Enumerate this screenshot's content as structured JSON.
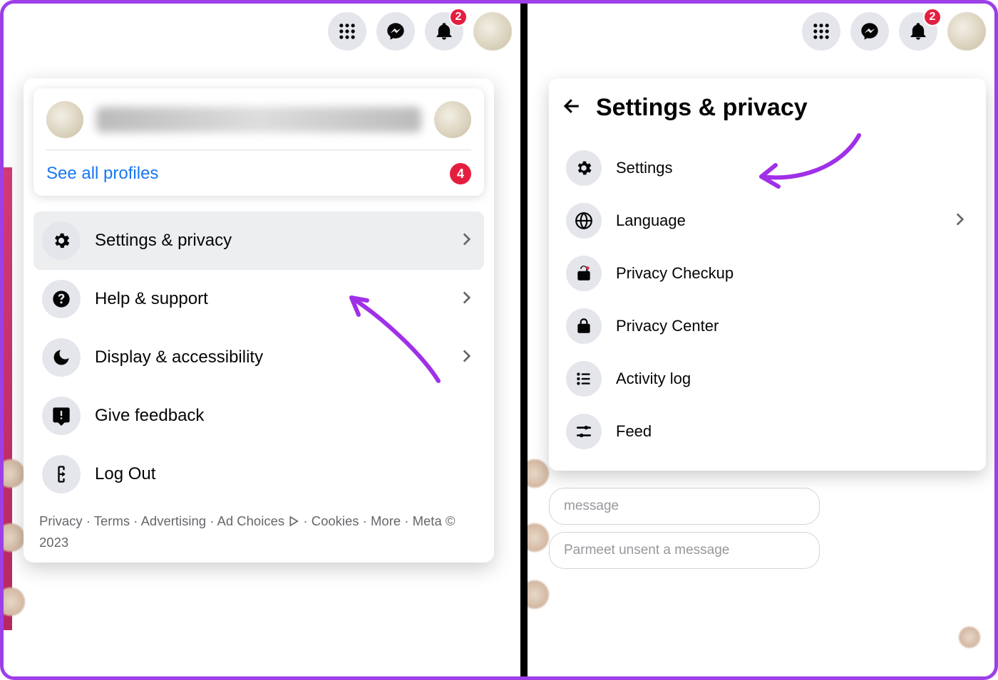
{
  "topbar": {
    "notification_count": "2"
  },
  "left_panel": {
    "see_all_profiles": "See all profiles",
    "profiles_count": "4",
    "items": [
      {
        "label": "Settings & privacy",
        "icon": "gear",
        "chevron": true,
        "highlight": true
      },
      {
        "label": "Help & support",
        "icon": "help",
        "chevron": true
      },
      {
        "label": "Display & accessibility",
        "icon": "moon",
        "chevron": true
      },
      {
        "label": "Give feedback",
        "icon": "feedback",
        "chevron": false
      },
      {
        "label": "Log Out",
        "icon": "logout",
        "chevron": false
      }
    ],
    "footer": {
      "privacy": "Privacy",
      "terms": "Terms",
      "advertising": "Advertising",
      "adchoices": "Ad Choices",
      "cookies": "Cookies",
      "more": "More",
      "meta": "Meta © 2023"
    }
  },
  "right_panel": {
    "title": "Settings & privacy",
    "items": [
      {
        "label": "Settings",
        "icon": "gear",
        "chevron": false
      },
      {
        "label": "Language",
        "icon": "globe",
        "chevron": true
      },
      {
        "label": "Privacy Checkup",
        "icon": "unlock",
        "chevron": false
      },
      {
        "label": "Privacy Center",
        "icon": "lock",
        "chevron": false
      },
      {
        "label": "Activity log",
        "icon": "list",
        "chevron": false
      },
      {
        "label": "Feed",
        "icon": "sliders",
        "chevron": false
      }
    ]
  },
  "bg_chat": {
    "line1": "message",
    "line2": "Parmeet unsent a message"
  }
}
